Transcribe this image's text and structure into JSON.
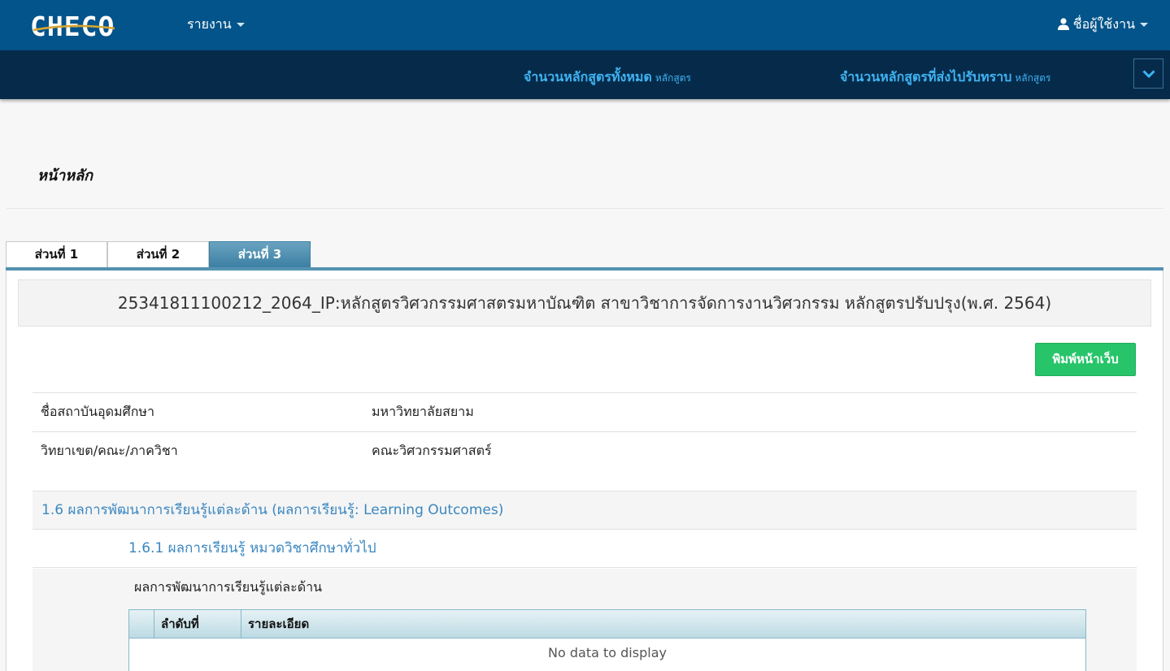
{
  "header": {
    "logo_text": "CHECO",
    "report_menu": "รายงาน",
    "user_menu": "ชื่อผู้ใช้งาน"
  },
  "subbar": {
    "total_label": "จำนวนหลักสูตรทั้งหมด",
    "total_unit": "หลักสูตร",
    "sent_label": "จำนวนหลักสูตรที่ส่งไปรับทราบ",
    "sent_unit": "หลักสูตร"
  },
  "page": {
    "title": "หน้าหลัก"
  },
  "tabs": [
    {
      "label": "ส่วนที่ 1",
      "active": false
    },
    {
      "label": "ส่วนที่ 2",
      "active": false
    },
    {
      "label": "ส่วนที่ 3",
      "active": true
    }
  ],
  "course": {
    "title": "25341811100212_2064_IP:หลักสูตรวิศวกรรมศาสตรมหาบัณฑิต สาขาวิชาการจัดการงานวิศวกรรม หลักสูตรปรับปรุง(พ.ศ. 2564)",
    "print_button": "พิมพ์หน้าเว็บ"
  },
  "info": [
    {
      "label": "ชื่อสถาบันอุดมศึกษา",
      "value": "มหาวิทยาลัยสยาม"
    },
    {
      "label": "วิทยาเขต/คณะ/ภาควิชา",
      "value": "คณะวิศวกรรมศาสตร์"
    }
  ],
  "sections": {
    "s16": "1.6 ผลการพัฒนาการเรียนรู้แต่ละด้าน (ผลการเรียนรู้: Learning Outcomes)",
    "s161": "1.6.1 ผลการเรียนรู้ หมวดวิชาศึกษาทั่วไป",
    "outcome_label": "ผลการพัฒนาการเรียนรู้แต่ละด้าน"
  },
  "grid": {
    "columns": [
      "",
      "ลำดับที่",
      "รายละเอียด"
    ],
    "empty_text": "No data to display"
  },
  "colors": {
    "topbar": "#03548a",
    "subbar": "#062b4a",
    "stat_text": "#3fb3f3",
    "print_button": "#27c46a",
    "section_link": "#3a87c0"
  }
}
